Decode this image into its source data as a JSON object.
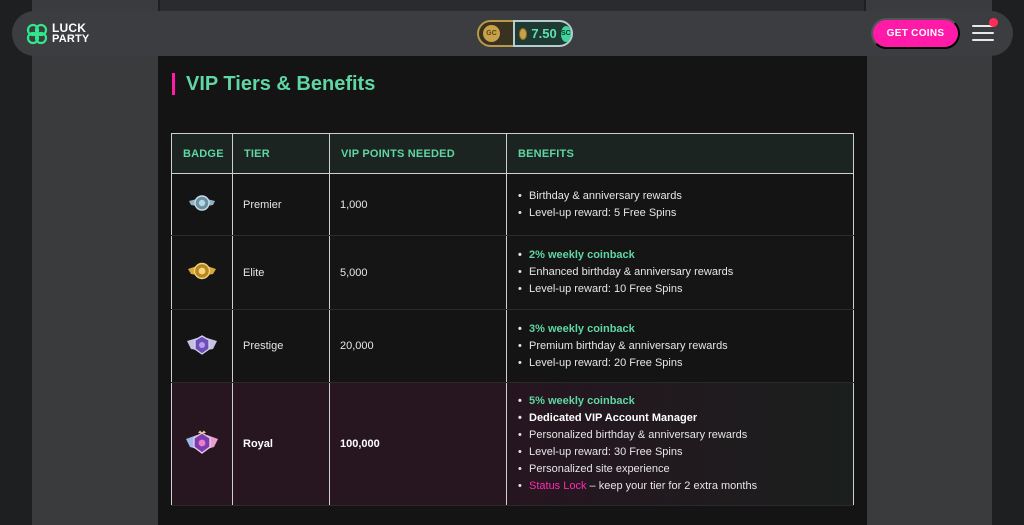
{
  "brand": {
    "logo_line1": "LUCK",
    "logo_line2": "PARTY",
    "accent": "#ff1aa7",
    "green": "#5fd6a4"
  },
  "header": {
    "gc_label": "GC",
    "sc_amount": "7.50",
    "sc_label": "SC",
    "get_coins_label": "GET COINS",
    "menu_icon": "hamburger-icon"
  },
  "section": {
    "title": "VIP Tiers & Benefits"
  },
  "table": {
    "columns": [
      "BADGE",
      "TIER",
      "VIP POINTS NEEDED",
      "BENEFITS"
    ],
    "rows": [
      {
        "badge_icon": "premier-badge-icon",
        "tier": "Premier",
        "points": "1,000",
        "benefits": [
          {
            "text": "Birthday & anniversary rewards",
            "style": "normal"
          },
          {
            "text": "Level-up reward: 5 Free Spins",
            "style": "normal"
          }
        ]
      },
      {
        "badge_icon": "elite-badge-icon",
        "tier": "Elite",
        "points": "5,000",
        "benefits": [
          {
            "text": "2% weekly coinback",
            "style": "green"
          },
          {
            "text": "Enhanced birthday & anniversary rewards",
            "style": "normal"
          },
          {
            "text": "Level-up reward: 10 Free Spins",
            "style": "normal"
          }
        ]
      },
      {
        "badge_icon": "prestige-badge-icon",
        "tier": "Prestige",
        "points": "20,000",
        "benefits": [
          {
            "text": "3% weekly coinback",
            "style": "green"
          },
          {
            "text": "Premium birthday & anniversary rewards",
            "style": "normal"
          },
          {
            "text": "Level-up reward: 20 Free Spins",
            "style": "normal"
          }
        ]
      },
      {
        "badge_icon": "royal-badge-icon",
        "tier": "Royal",
        "points": "100,000",
        "benefits": [
          {
            "text": "5% weekly coinback",
            "style": "green"
          },
          {
            "text": "Dedicated VIP Account Manager",
            "style": "bold"
          },
          {
            "text": "Personalized birthday & anniversary rewards",
            "style": "normal"
          },
          {
            "text": "Level-up reward: 30 Free Spins",
            "style": "normal"
          },
          {
            "text": "Personalized site experience",
            "style": "normal"
          },
          {
            "text_link": "Status Lock",
            "text_rest": " – keep your tier for 2 extra months",
            "style": "link"
          }
        ]
      }
    ]
  }
}
